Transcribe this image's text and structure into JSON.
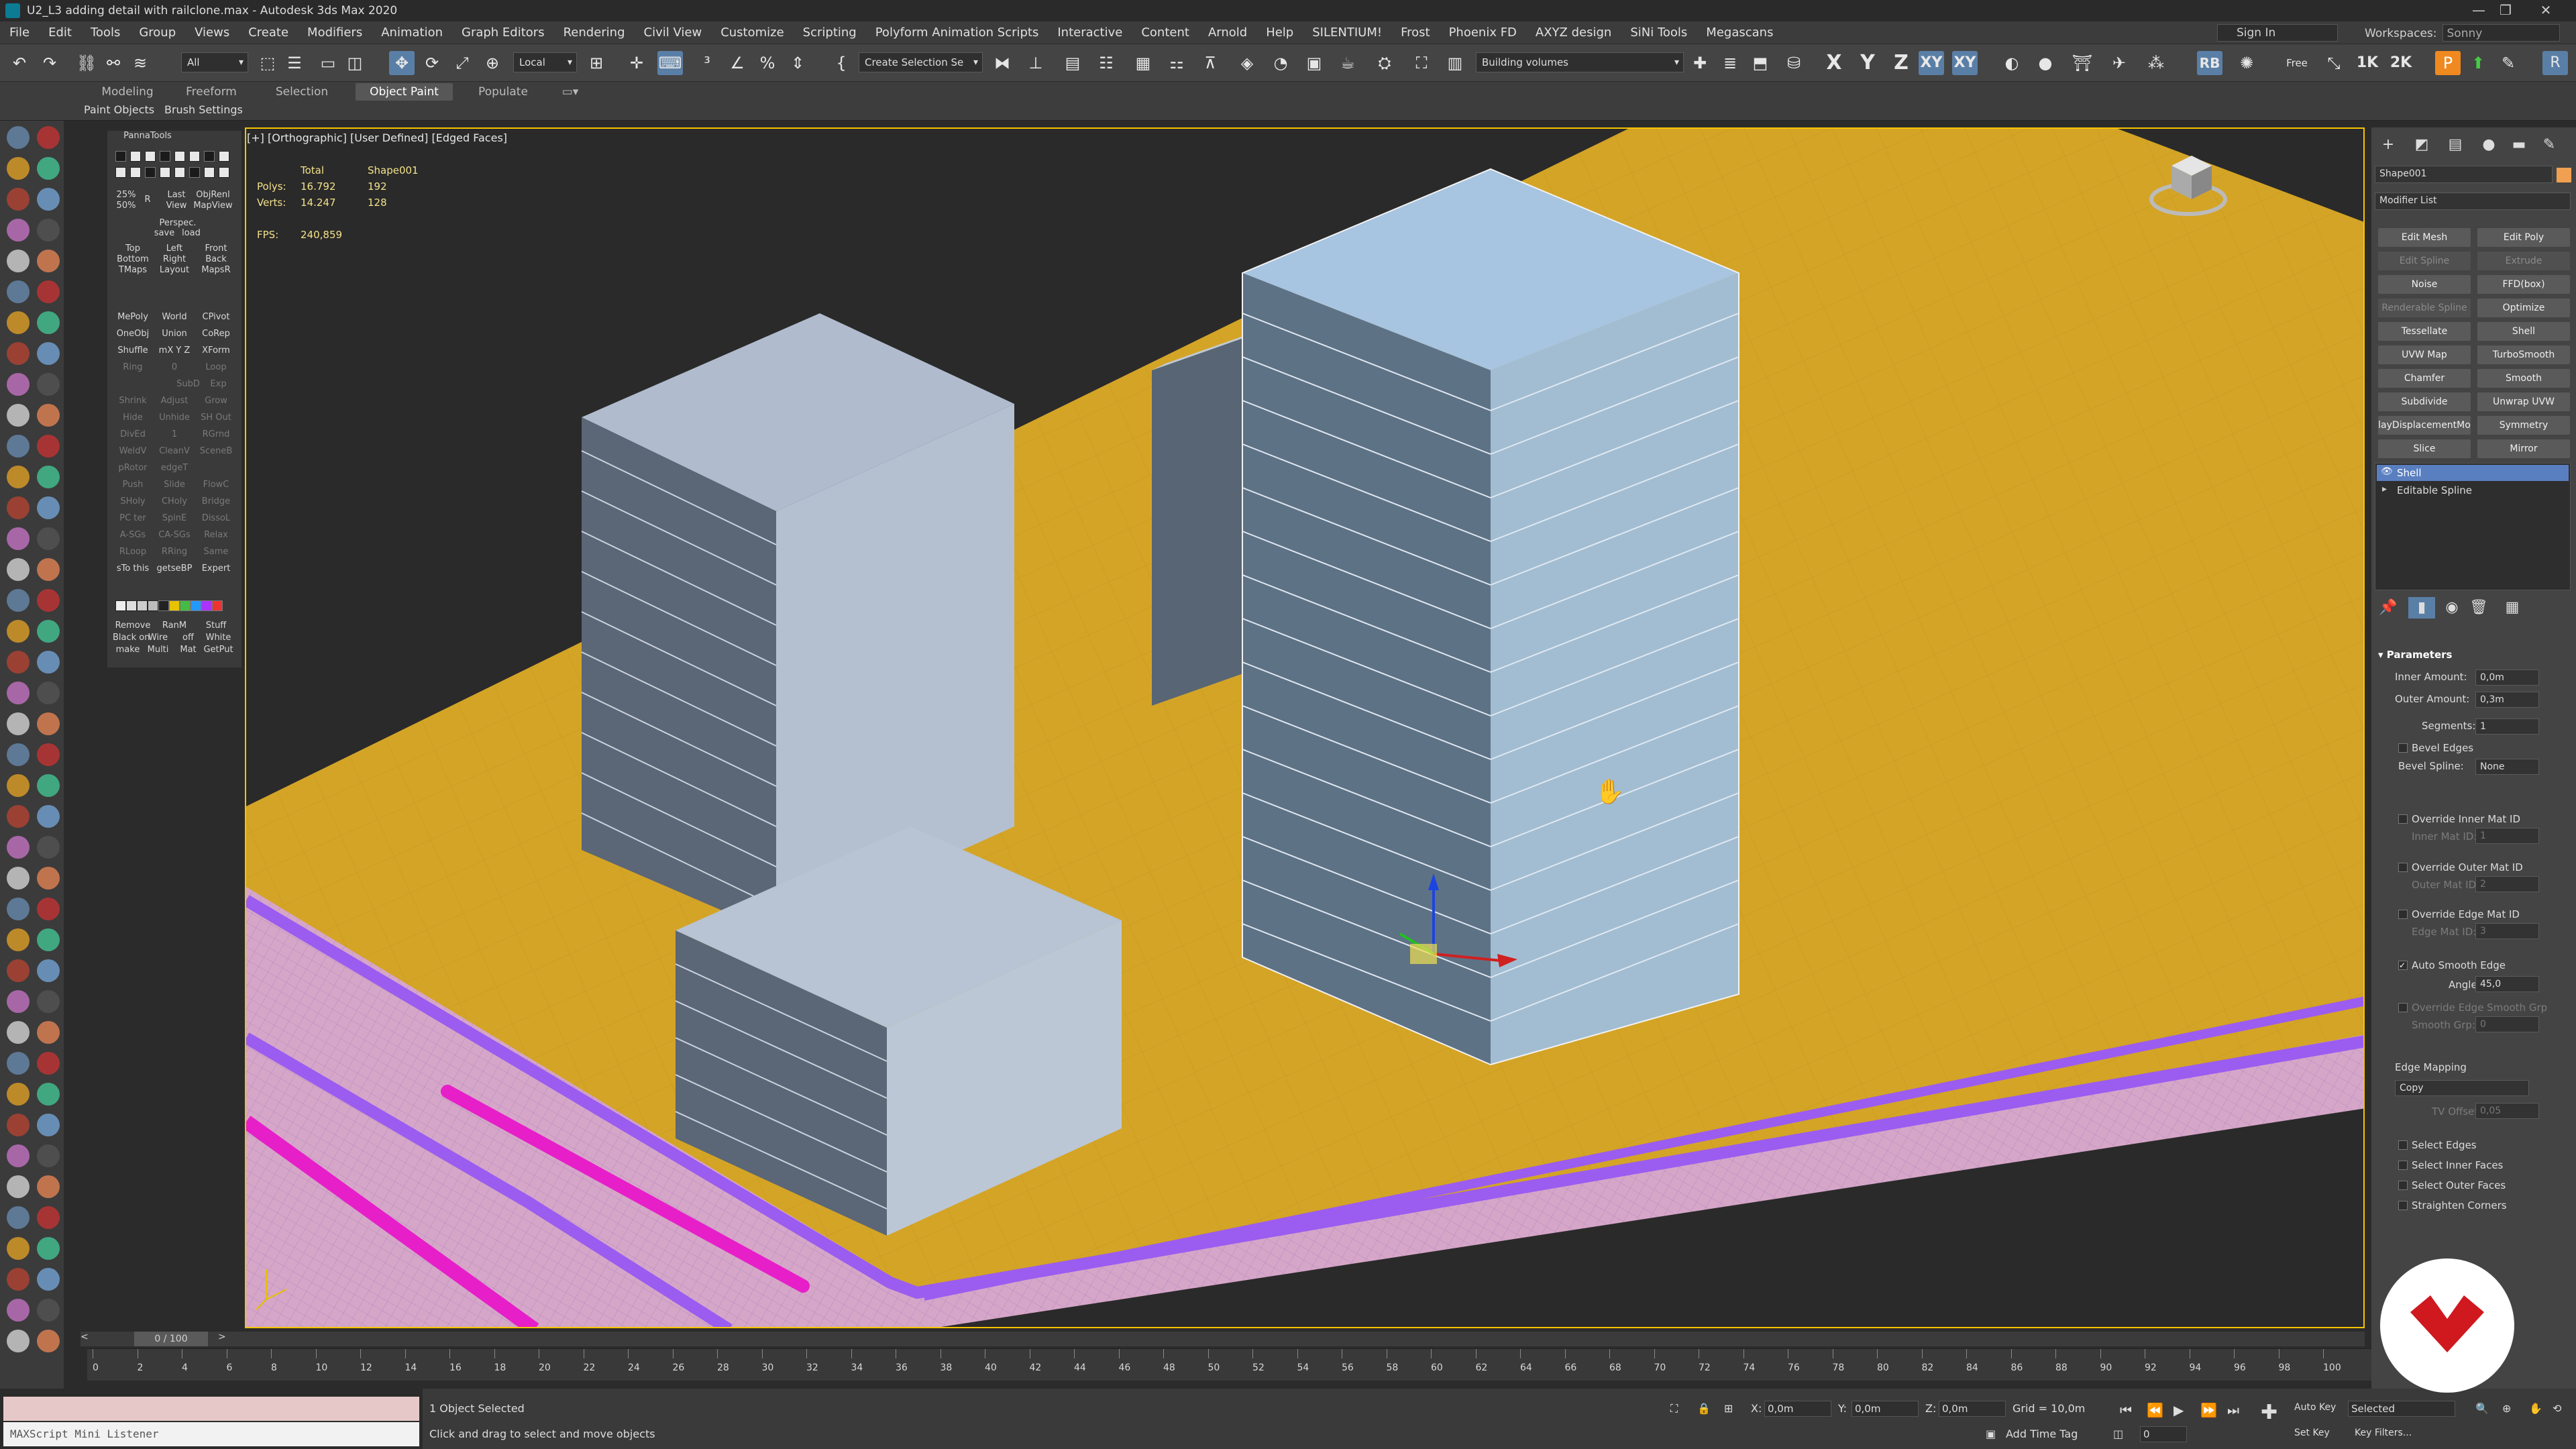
{
  "window": {
    "title": "U2_L3 adding detail with railclone.max - Autodesk 3ds Max 2020"
  },
  "menu": [
    "File",
    "Edit",
    "Tools",
    "Group",
    "Views",
    "Create",
    "Modifiers",
    "Animation",
    "Graph Editors",
    "Rendering",
    "Civil View",
    "Customize",
    "Scripting",
    "Polyform Animation Scripts",
    "Interactive",
    "Content",
    "Arnold",
    "Help",
    "SILENTIUM!",
    "Frost",
    "Phoenix FD",
    "AXYZ design",
    "SiNi Tools",
    "Megascans"
  ],
  "signin": "Sign In",
  "workspaces": {
    "label": "Workspaces:",
    "value": "Sonny"
  },
  "toolbar": {
    "filter": "All",
    "coord_system": "Local",
    "selection_set": "Create Selection Se",
    "layer": "Building volumes",
    "quality_a": "1K",
    "quality_b": "2K",
    "axis_x": "X",
    "axis_y": "Y",
    "axis_z": "Z",
    "axis_xy": "XY",
    "axis_xy2": "XY",
    "free": "Free"
  },
  "ribbon": {
    "tabs": [
      "Modeling",
      "Freeform",
      "Selection",
      "Object Paint",
      "Populate"
    ],
    "sub": [
      "Paint Objects",
      "Brush Settings"
    ]
  },
  "custom_panel": {
    "title": "PannaTools",
    "pct": [
      "25%",
      "50%"
    ],
    "r_label": "R",
    "grid1": [
      [
        "Last",
        "ObjRenl"
      ],
      [
        "View",
        "MapView"
      ]
    ],
    "persp": [
      "Perspec.",
      "save",
      "load"
    ],
    "views": [
      [
        "Top",
        "Left",
        "Front"
      ],
      [
        "Bottom",
        "Right",
        "Back"
      ],
      [
        "TMaps",
        "Layout",
        "MapsR"
      ]
    ],
    "ops": [
      [
        "MePoly",
        "World",
        "CPivot"
      ],
      [
        "OneObj",
        "Union",
        "CoRep"
      ],
      [
        "Shuffle",
        "mX Y Z",
        "XForm"
      ],
      [
        "Ring",
        "0",
        "Loop"
      ],
      [
        "",
        "",
        "SubD",
        "Exp"
      ],
      [
        "Shrink",
        "Adjust",
        "Grow"
      ],
      [
        "Hide",
        "Unhide",
        "SH Out"
      ],
      [
        "DivEd",
        "1",
        "RGrnd"
      ],
      [
        "WeldV",
        "CleanV",
        "SceneB"
      ],
      [
        "pRotor",
        "edgeT",
        ""
      ],
      [
        "Push",
        "Slide",
        "FlowC"
      ],
      [
        "SHoly",
        "CHoly",
        "Bridge"
      ],
      [
        "PC ter",
        "SpinE",
        "DissoL"
      ],
      [
        "A-SGs",
        "CA-SGs",
        "Relax"
      ],
      [
        "RLoop",
        "RRing",
        "Same"
      ],
      [
        "sTo this",
        "getseBP",
        "Expert"
      ]
    ],
    "bottom": [
      [
        "Remove",
        "RanM",
        "Stuff"
      ],
      [
        "Black on",
        "Wire",
        "off",
        "White"
      ],
      [
        "make",
        "Multi",
        "Mat",
        "GetPut"
      ]
    ]
  },
  "viewport": {
    "label": "[+] [Orthographic] [User Defined] [Edged Faces]",
    "stats": {
      "header_total": "Total",
      "header_obj": "Shape001",
      "polys_label": "Polys:",
      "polys_total": "16.792",
      "polys_obj": "192",
      "verts_label": "Verts:",
      "verts_total": "14.247",
      "verts_obj": "128",
      "fps_label": "FPS:",
      "fps_value": "240,859"
    }
  },
  "command_panel": {
    "object_name": "Shape001",
    "object_color": "#f0a050",
    "modifier_list": "Modifier List",
    "buttons": [
      [
        "Edit Mesh",
        "Edit Poly"
      ],
      [
        "Edit Spline",
        "Extrude"
      ],
      [
        "Noise",
        "FFD(box)"
      ],
      [
        "Renderable Spline",
        "Optimize"
      ],
      [
        "Tessellate",
        "Shell"
      ],
      [
        "UVW Map",
        "TurboSmooth"
      ],
      [
        "Chamfer",
        "Smooth"
      ],
      [
        "Subdivide",
        "Unwrap UVW"
      ],
      [
        "layDisplacementMo",
        "Symmetry"
      ],
      [
        "Slice",
        "Mirror"
      ]
    ],
    "disabled": [
      "Edit Spline",
      "Extrude",
      "Renderable Spline"
    ],
    "stack": [
      "Shell",
      "Editable Spline"
    ],
    "parameters_title": "Parameters",
    "inner_amount": {
      "label": "Inner Amount:",
      "value": "0,0m"
    },
    "outer_amount": {
      "label": "Outer Amount:",
      "value": "0,3m"
    },
    "segments": {
      "label": "Segments:",
      "value": "1"
    },
    "bevel_edges": "Bevel Edges",
    "bevel_spline": {
      "label": "Bevel Spline:",
      "value": "None"
    },
    "override_inner": "Override Inner Mat ID",
    "inner_mat_id": {
      "label": "Inner Mat ID:",
      "value": "1"
    },
    "override_outer": "Override Outer Mat ID",
    "outer_mat_id": {
      "label": "Outer Mat ID:",
      "value": "2"
    },
    "override_edge": "Override Edge Mat ID",
    "edge_mat_id": {
      "label": "Edge Mat ID:",
      "value": "3"
    },
    "auto_smooth": "Auto Smooth Edge",
    "angle": {
      "label": "Angle:",
      "value": "45,0"
    },
    "override_smooth": "Override Edge Smooth Grp",
    "smooth_grp": {
      "label": "Smooth Grp:",
      "value": "0"
    },
    "edge_mapping": "Edge Mapping",
    "edge_mapping_value": "Copy",
    "tv_offset": {
      "label": "TV Offset:",
      "value": "0,05"
    },
    "checks": [
      "Select Edges",
      "Select Inner Faces",
      "Select Outer Faces",
      "Straighten Corners"
    ]
  },
  "timeline": {
    "frame": "0 / 100",
    "ticks": [
      "0",
      "2",
      "4",
      "6",
      "8",
      "10",
      "12",
      "14",
      "16",
      "18",
      "20",
      "22",
      "24",
      "26",
      "28",
      "30",
      "32",
      "34",
      "36",
      "38",
      "40",
      "42",
      "44",
      "46",
      "48",
      "50",
      "52",
      "54",
      "56",
      "58",
      "60",
      "62",
      "64",
      "66",
      "68",
      "70",
      "72",
      "74",
      "76",
      "78",
      "80",
      "82",
      "84",
      "86",
      "88",
      "90",
      "92",
      "94",
      "96",
      "98",
      "100"
    ]
  },
  "listener": {
    "placeholder": "MAXScript Mini Listener"
  },
  "status": {
    "selected": "1 Object Selected",
    "prompt": "Click and drag to select and move objects",
    "x_label": "X:",
    "x": "0,0m",
    "y_label": "Y:",
    "y": "0,0m",
    "z_label": "Z:",
    "z": "0,0m",
    "grid": "Grid = 10,0m",
    "add_time_tag": "Add Time Tag",
    "auto_key": "Auto Key",
    "key_mode": "Selected",
    "set_key": "Set Key",
    "key_filters": "Key Filters...",
    "current_frame": "0"
  },
  "colors": {
    "accent": "#5a7fa6",
    "ground": "#d4a426",
    "road_edge": "#9b5cf0",
    "pipe": "#e61fc9",
    "logo_red": "#d0181f"
  },
  "icons": [
    "undo-icon",
    "redo-icon",
    "link-icon",
    "unlink-icon",
    "bind-icon",
    "select-icon",
    "select-by-name-icon",
    "rect-select-icon",
    "window-crossing-icon",
    "move-icon",
    "rotate-icon",
    "scale-icon",
    "place-icon",
    "snap-icon",
    "angle-snap-icon",
    "percent-snap-icon",
    "spinner-snap-icon",
    "mirror-icon",
    "align-icon",
    "layer-icon",
    "render-icon",
    "teapot-icon",
    "gizmo-icon",
    "viewcube-icon",
    "logo-icon"
  ]
}
